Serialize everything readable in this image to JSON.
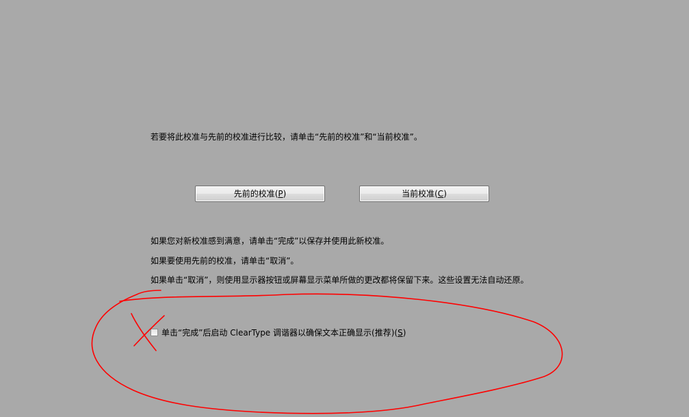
{
  "instructions": {
    "compare": "若要将此校准与先前的校准进行比较，请单击“先前的校准”和“当前校准”。",
    "finish": "如果您对新校准感到满意，请单击“完成”以保存并使用此新校准。",
    "cancel": "如果要使用先前的校准，请单击“取消”。",
    "warning": "如果单击“取消”，则使用显示器按钮或屏幕显示菜单所做的更改都将保留下来。这些设置无法自动还原。"
  },
  "buttons": {
    "previous": {
      "text": "先前的校准(",
      "key": "P",
      "end": ")"
    },
    "current": {
      "text": "当前校准(",
      "key": "C",
      "end": ")"
    }
  },
  "cleartype": {
    "checked": false,
    "label_text": "单击“完成”后启动 ClearType 调谐器以确保文本正确显示(推荐)(",
    "key": "S",
    "end": ")"
  },
  "colors": {
    "background": "#a9a9a9",
    "annotation": "#ff0000"
  }
}
